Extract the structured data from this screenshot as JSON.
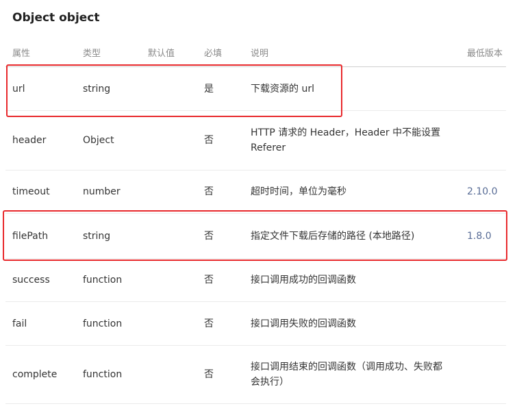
{
  "title": "Object object",
  "headers": {
    "name": "属性",
    "type": "类型",
    "default": "默认值",
    "required": "必填",
    "description": "说明",
    "min_version": "最低版本"
  },
  "rows": [
    {
      "name": "url",
      "type": "string",
      "default": "",
      "required": "是",
      "description": "下载资源的 url",
      "min_version": ""
    },
    {
      "name": "header",
      "type": "Object",
      "default": "",
      "required": "否",
      "description": "HTTP 请求的 Header，Header 中不能设置 Referer",
      "min_version": ""
    },
    {
      "name": "timeout",
      "type": "number",
      "default": "",
      "required": "否",
      "description": "超时时间，单位为毫秒",
      "min_version": "2.10.0"
    },
    {
      "name": "filePath",
      "type": "string",
      "default": "",
      "required": "否",
      "description": "指定文件下载后存储的路径 (本地路径)",
      "min_version": "1.8.0"
    },
    {
      "name": "success",
      "type": "function",
      "default": "",
      "required": "否",
      "description": "接口调用成功的回调函数",
      "min_version": ""
    },
    {
      "name": "fail",
      "type": "function",
      "default": "",
      "required": "否",
      "description": "接口调用失败的回调函数",
      "min_version": ""
    },
    {
      "name": "complete",
      "type": "function",
      "default": "",
      "required": "否",
      "description": "接口调用结束的回调函数（调用成功、失败都会执行）",
      "min_version": ""
    }
  ],
  "colors": {
    "highlight": "#e8282b",
    "version_link": "#576b95"
  }
}
